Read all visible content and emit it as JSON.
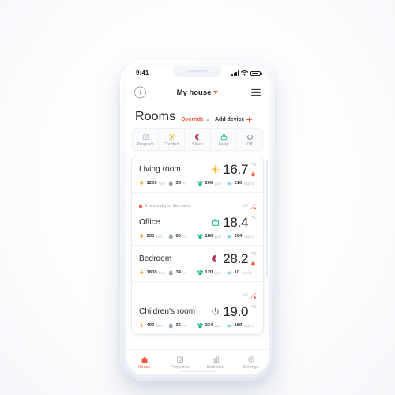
{
  "statusbar": {
    "time": "9:41",
    "signal_icon": "signal-bars-icon",
    "wifi_icon": "wifi-icon",
    "battery_icon": "battery-icon"
  },
  "header": {
    "info_icon": "info-icon",
    "title": "My house",
    "chevron_icon": "chevron-down-icon",
    "menu_icon": "hamburger-menu-icon"
  },
  "title_row": {
    "page_title": "Rooms",
    "override_label": "Override",
    "override_chevron": "chevron-up-icon",
    "add_device_label": "Add device",
    "add_device_icon": "plus-icon"
  },
  "modes": [
    {
      "label": "Program",
      "icon": "calendar-icon",
      "color": "#b9bec8"
    },
    {
      "label": "Comfort",
      "icon": "sun-icon",
      "color": "#f7b32b"
    },
    {
      "label": "Sleep",
      "icon": "moon-icon",
      "color": "#b6314f"
    },
    {
      "label": "Away",
      "icon": "briefcase-icon",
      "color": "#2bbd8a"
    },
    {
      "label": "Off",
      "icon": "power-icon",
      "color": "#6b717c"
    }
  ],
  "rooms": [
    {
      "name": "Living room",
      "mode_icon": "sun-icon",
      "mode_color": "#f7b32b",
      "temperature": "16.7",
      "degree_unit": "°C",
      "heating": true,
      "warning": null,
      "alert_count": null,
      "metrics": [
        {
          "icon": "bolt-icon",
          "value": "1200",
          "unit": "kwh",
          "color": "#f7a325"
        },
        {
          "icon": "droplet-icon",
          "value": "36",
          "unit": "%",
          "color": "#9aa4b0"
        },
        {
          "icon": "co2-icon",
          "value": "200",
          "unit": "ppm",
          "color": "#17b978"
        },
        {
          "icon": "cloud-icon",
          "value": "210",
          "unit": "mg/m3",
          "color": "#8ed6ec"
        }
      ]
    },
    {
      "name": "Office",
      "mode_icon": "briefcase-icon",
      "mode_color": "#2bbd8a",
      "temperature": "18.4",
      "degree_unit": "°C",
      "heating": false,
      "warning": "It is too dry in the room.",
      "alert_count": "1/2",
      "metrics": [
        {
          "icon": "bolt-icon",
          "value": "230",
          "unit": "kwh",
          "color": "#f7a325"
        },
        {
          "icon": "droplet-icon",
          "value": "80",
          "unit": "%",
          "color": "#9aa4b0"
        },
        {
          "icon": "co2-icon",
          "value": "180",
          "unit": "ppm",
          "color": "#17b978"
        },
        {
          "icon": "cloud-icon",
          "value": "204",
          "unit": "mg/m3",
          "color": "#8ed6ec"
        }
      ]
    },
    {
      "name": "Bedroom",
      "mode_icon": "moon-icon",
      "mode_color": "#b6314f",
      "temperature": "28.2",
      "degree_unit": "°C",
      "heating": true,
      "warning": null,
      "alert_count": null,
      "metrics": [
        {
          "icon": "bolt-icon",
          "value": "1800",
          "unit": "kwh",
          "color": "#f7a325"
        },
        {
          "icon": "droplet-icon",
          "value": "34",
          "unit": "%",
          "color": "#9aa4b0"
        },
        {
          "icon": "co2-icon",
          "value": "120",
          "unit": "ppm",
          "color": "#17b978"
        },
        {
          "icon": "cloud-icon",
          "value": "10",
          "unit": "mg/m3",
          "color": "#8ed6ec"
        }
      ]
    },
    {
      "name": "Children's room",
      "mode_icon": "power-icon",
      "mode_color": "#6b717c",
      "temperature": "19.0",
      "degree_unit": "°C",
      "heating": false,
      "warning": "",
      "alert_count": "1/2",
      "metrics": [
        {
          "icon": "bolt-icon",
          "value": "400",
          "unit": "kwh",
          "color": "#f7a325"
        },
        {
          "icon": "droplet-icon",
          "value": "35",
          "unit": "%",
          "color": "#9aa4b0"
        },
        {
          "icon": "co2-icon",
          "value": "234",
          "unit": "ppm",
          "color": "#17b978"
        },
        {
          "icon": "cloud-icon",
          "value": "189",
          "unit": "mg/m3",
          "color": "#8ed6ec"
        }
      ]
    }
  ],
  "bottom_nav": [
    {
      "label": "House",
      "icon": "home-icon",
      "active": true
    },
    {
      "label": "Programs",
      "icon": "calendar-icon",
      "active": false
    },
    {
      "label": "Statistics",
      "icon": "bar-chart-icon",
      "active": false
    },
    {
      "label": "Settings",
      "icon": "gear-icon",
      "active": false
    }
  ],
  "colors": {
    "accent": "#f4573c",
    "text_primary": "#23262d",
    "text_muted": "#a0a6b0"
  }
}
